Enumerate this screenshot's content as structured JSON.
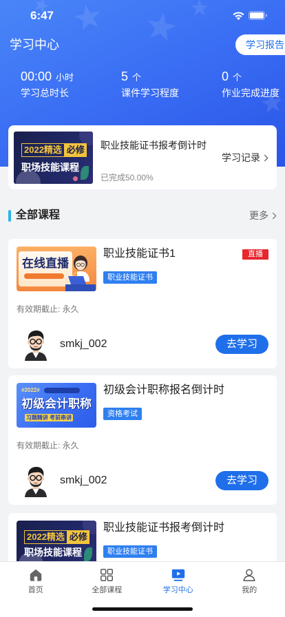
{
  "colors": {
    "primary": "#1f6fea",
    "header_start": "#4a86f8",
    "header_end": "#2a55e7",
    "live_badge": "#e7262d",
    "tag": "#2f7ff0",
    "section_bar": "#2bb4e6",
    "page_bg": "#f2f3f5"
  },
  "status_bar": {
    "time": "6:47",
    "icons": [
      "wifi-icon",
      "battery-icon"
    ]
  },
  "header": {
    "title": "学习中心",
    "report_button": "学习报告",
    "stats": [
      {
        "value": "00:00",
        "unit": "小时",
        "label": "学习总时长"
      },
      {
        "value": "5",
        "unit": "个",
        "label": "课件学习程度"
      },
      {
        "value": "0",
        "unit": "个",
        "label": "作业完成进度"
      }
    ]
  },
  "recent": {
    "thumb": {
      "line1": "2022精选",
      "badge": "必修",
      "line2": "职场技能课程"
    },
    "title": "职业技能证书报考倒计时",
    "record_link": "学习记录",
    "progress_text": "已完成50.00%"
  },
  "section": {
    "title": "全部课程",
    "more": "更多"
  },
  "courses": [
    {
      "thumb": {
        "headline": "在线直播"
      },
      "title": "职业技能证书1",
      "badge": "直播",
      "tag": "职业技能证书",
      "validity": "有效期截止: 永久",
      "teacher": "smkj_002",
      "action": "去学习"
    },
    {
      "thumb": {
        "hashtag": "#2022#",
        "headline": "初级会计职称",
        "strip": "习题精讲 考前串讲"
      },
      "title": "初级会计职称报名倒计时",
      "tag": "资格考试",
      "validity": "有效期截止: 永久",
      "teacher": "smkj_002",
      "action": "去学习"
    },
    {
      "thumb": {
        "line1": "2022精选",
        "badge": "必修",
        "line2": "职场技能课程"
      },
      "title": "职业技能证书报考倒计时",
      "tag": "职业技能证书"
    }
  ],
  "tabbar": {
    "active_index": 2,
    "items": [
      {
        "label": "首页",
        "icon": "home-icon"
      },
      {
        "label": "全部课程",
        "icon": "grid-icon"
      },
      {
        "label": "学习中心",
        "icon": "study-play-icon"
      },
      {
        "label": "我的",
        "icon": "user-icon"
      }
    ]
  }
}
